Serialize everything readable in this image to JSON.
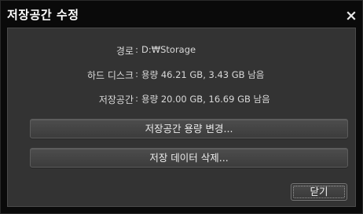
{
  "dialog": {
    "title": "저장공간 수정"
  },
  "info": {
    "path": {
      "label": "경로",
      "separator": ":",
      "value": "D:₩Storage"
    },
    "disk": {
      "label": "하드 디스크",
      "separator": ":",
      "value": "용량 46.21 GB, 3.43 GB 남음"
    },
    "storage": {
      "label": "저장공간",
      "separator": ":",
      "value": "용량 20.00 GB, 16.69 GB 남음"
    }
  },
  "actions": {
    "change_capacity_label": "저장공간 용량 변경...",
    "delete_data_label": "저장 데이터 삭제...",
    "close_label": "닫기"
  },
  "icons": {
    "close": "close-icon"
  },
  "colors": {
    "window_bg": "#0a0a0a",
    "panel_bg": "#333333",
    "text": "#d8d8d8",
    "title_text": "#ffffff"
  }
}
